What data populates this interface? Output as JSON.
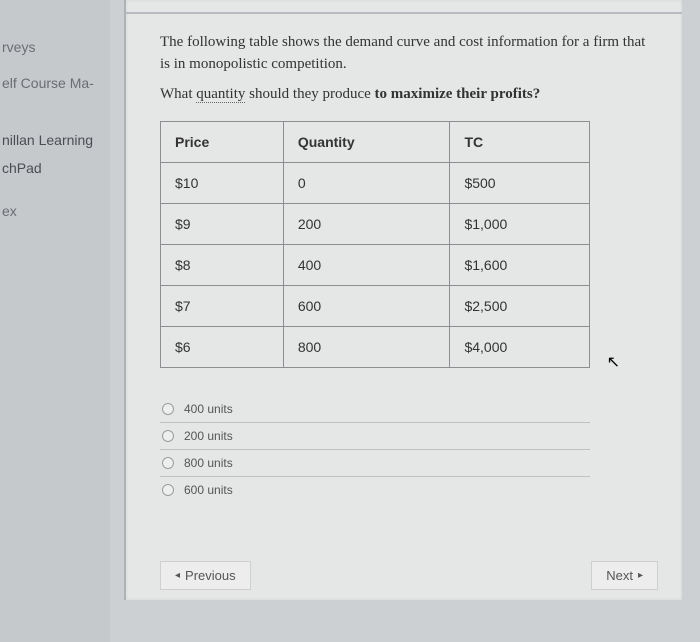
{
  "sidebar": {
    "items": [
      {
        "label": "rveys"
      },
      {
        "label": "elf Course Ma-"
      },
      {
        "label": "nillan Learning"
      },
      {
        "label": "chPad"
      },
      {
        "label": "ex"
      }
    ]
  },
  "prompt": {
    "line1": "The following table shows the demand curve and cost information for a firm that is in monopolistic competition.",
    "q_prefix": "What ",
    "q_underlined": "quantity",
    "q_mid": " should they produce ",
    "q_bold": "to maximize their profits?"
  },
  "table": {
    "headers": [
      "Price",
      "Quantity",
      "TC"
    ],
    "rows": [
      [
        "$10",
        "0",
        "$500"
      ],
      [
        "$9",
        "200",
        "$1,000"
      ],
      [
        "$8",
        "400",
        "$1,600"
      ],
      [
        "$7",
        "600",
        "$2,500"
      ],
      [
        "$6",
        "800",
        "$4,000"
      ]
    ]
  },
  "options": [
    "400 units",
    "200 units",
    "800 units",
    "600 units"
  ],
  "nav": {
    "prev": "Previous",
    "next": "Next"
  },
  "chart_data": {
    "type": "table",
    "title": "Demand curve and cost information (monopolistic competition)",
    "columns": [
      "Price",
      "Quantity",
      "TC"
    ],
    "rows": [
      {
        "Price": 10,
        "Quantity": 0,
        "TC": 500
      },
      {
        "Price": 9,
        "Quantity": 200,
        "TC": 1000
      },
      {
        "Price": 8,
        "Quantity": 400,
        "TC": 1600
      },
      {
        "Price": 7,
        "Quantity": 600,
        "TC": 2500
      },
      {
        "Price": 6,
        "Quantity": 800,
        "TC": 4000
      }
    ]
  }
}
